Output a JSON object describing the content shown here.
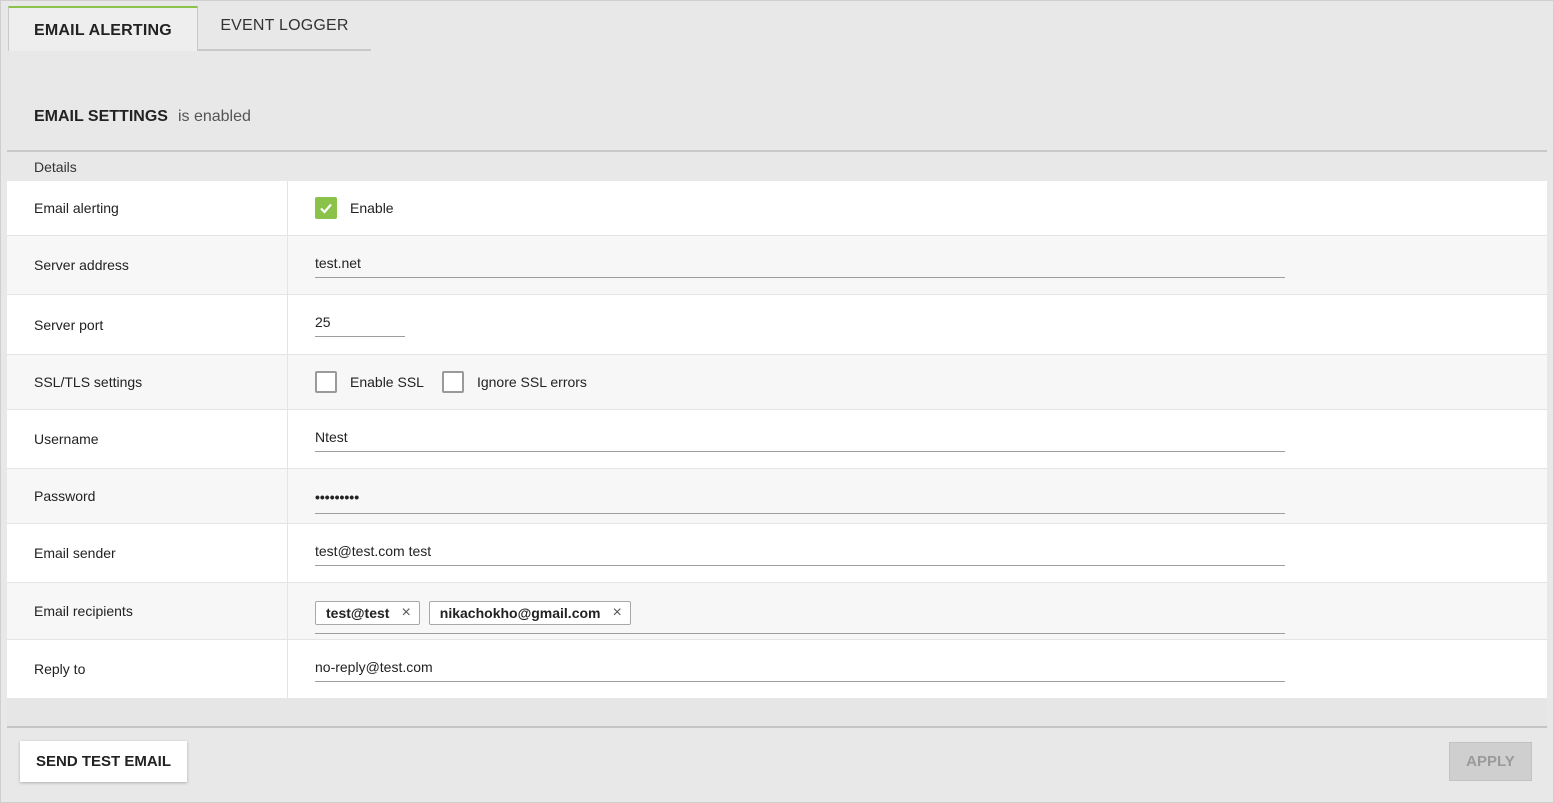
{
  "tabs": {
    "email_alerting": "EMAIL ALERTING",
    "event_logger": "EVENT LOGGER"
  },
  "section": {
    "title": "EMAIL SETTINGS",
    "status": "is enabled",
    "details_label": "Details"
  },
  "fields": {
    "email_alerting": {
      "label": "Email alerting",
      "checkbox_label": "Enable",
      "checked": true
    },
    "server_address": {
      "label": "Server address",
      "value": "test.net"
    },
    "server_port": {
      "label": "Server port",
      "value": "25"
    },
    "ssl_tls": {
      "label": "SSL/TLS settings",
      "enable_ssl_label": "Enable SSL",
      "enable_ssl_checked": false,
      "ignore_ssl_label": "Ignore SSL errors",
      "ignore_ssl_checked": false
    },
    "username": {
      "label": "Username",
      "value": "Ntest"
    },
    "password": {
      "label": "Password",
      "value": "•••••••••"
    },
    "email_sender": {
      "label": "Email sender",
      "value": "test@test.com test"
    },
    "email_recipients": {
      "label": "Email recipients",
      "chips": [
        "test@test",
        "nikachokho@gmail.com"
      ],
      "remove_glyph": "×"
    },
    "reply_to": {
      "label": "Reply to",
      "value": "no-reply@test.com"
    }
  },
  "buttons": {
    "send_test_email": "SEND TEST EMAIL",
    "apply": "APPLY"
  },
  "colors": {
    "accent": "#8bc34a",
    "background": "#e8e8e8",
    "row_alt": "#f7f7f7"
  }
}
